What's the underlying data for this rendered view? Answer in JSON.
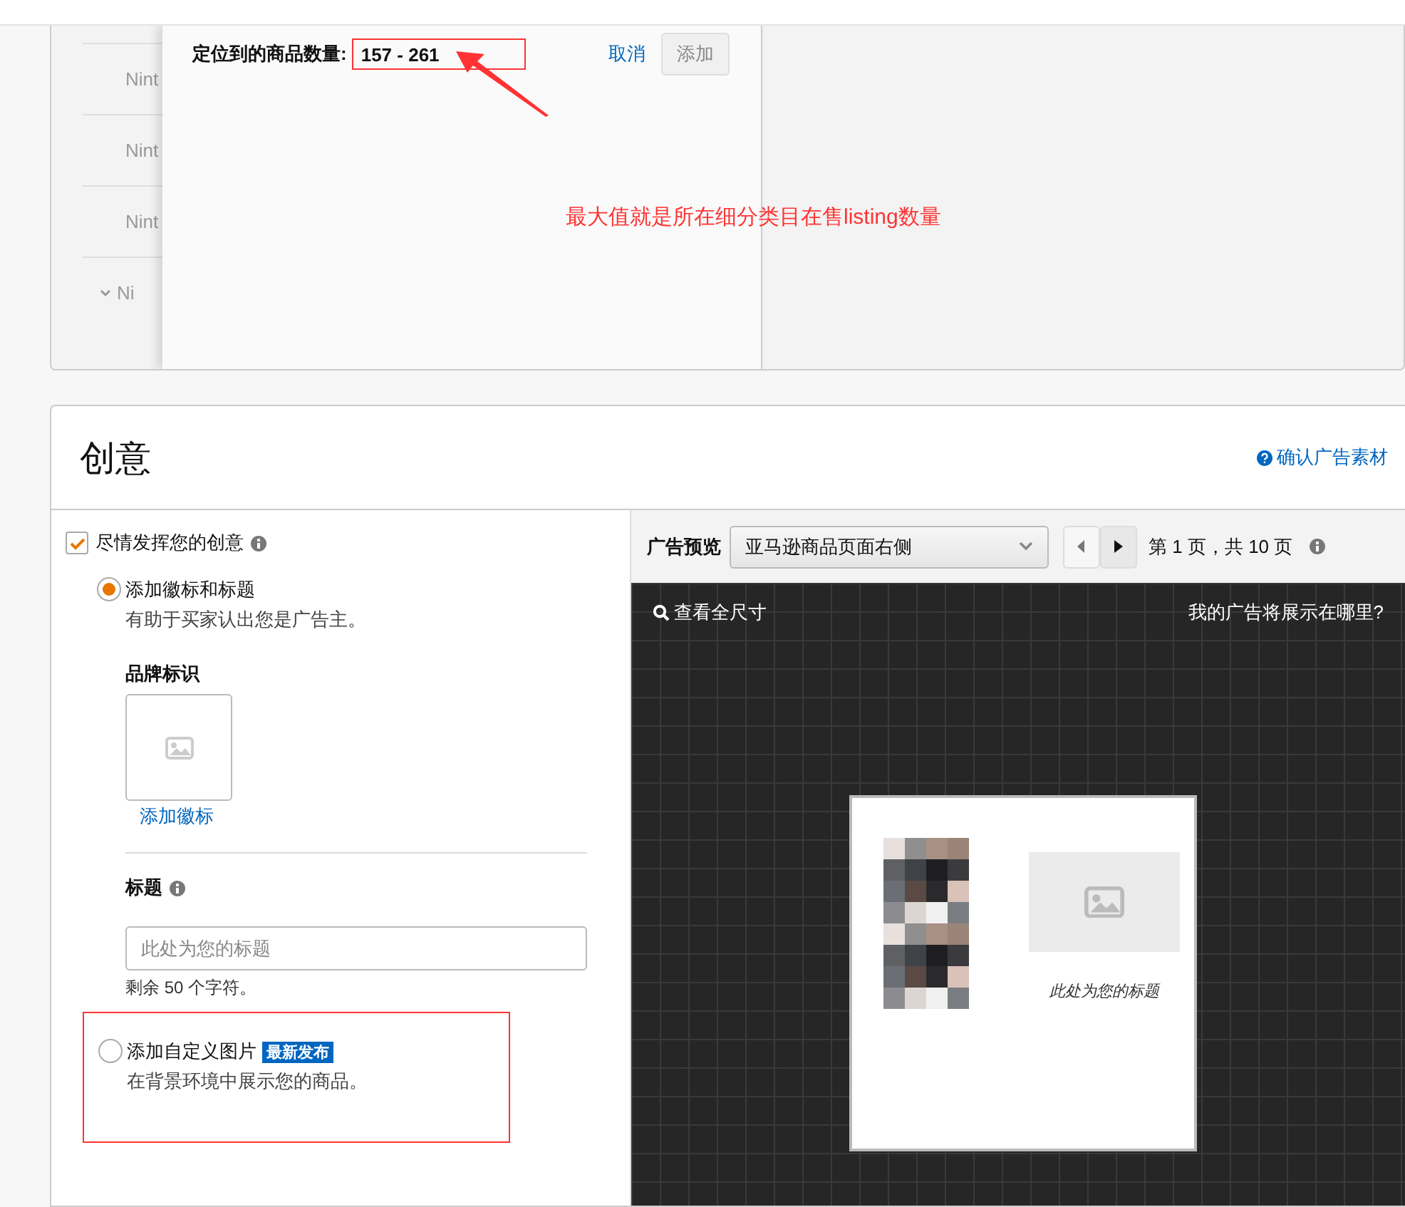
{
  "targeting_list": {
    "rows": [
      {
        "label": "Nint",
        "expandable": false
      },
      {
        "label": "Nint",
        "expandable": false
      },
      {
        "label": "Nint",
        "expandable": false
      },
      {
        "label": "Ni",
        "expandable": true
      }
    ]
  },
  "targeting_panel": {
    "count_label": "定位到的商品数量:",
    "count_value": "157 - 261",
    "cancel": "取消",
    "add": "添加",
    "add_disabled": true
  },
  "annotation": {
    "note": "最大值就是所在细分类目在售listing数量"
  },
  "creative": {
    "title": "创意",
    "confirm_link": "确认广告素材",
    "enable": {
      "label": "尽情发挥您的创意",
      "checked": true
    },
    "options": [
      {
        "kind": "logo_headline",
        "label": "添加徽标和标题",
        "description": "有助于买家认出您是广告主。",
        "selected": true
      },
      {
        "kind": "custom_image",
        "label": "添加自定义图片",
        "badge": "最新发布",
        "description": "在背景环境中展示您的商品。",
        "selected": false
      }
    ],
    "logo": {
      "label": "品牌标识",
      "add_link": "添加徽标"
    },
    "headline": {
      "label": "标题",
      "placeholder": "此处为您的标题",
      "remaining": "剩余 50 个字符。"
    }
  },
  "preview": {
    "label": "广告预览",
    "placement": "亚马逊商品页面右侧",
    "page_info": "第 1 页，共 10 页",
    "full_size": "查看全尺寸",
    "where_link": "我的广告将展示在哪里?",
    "ad_headline": "此处为您的标题"
  }
}
